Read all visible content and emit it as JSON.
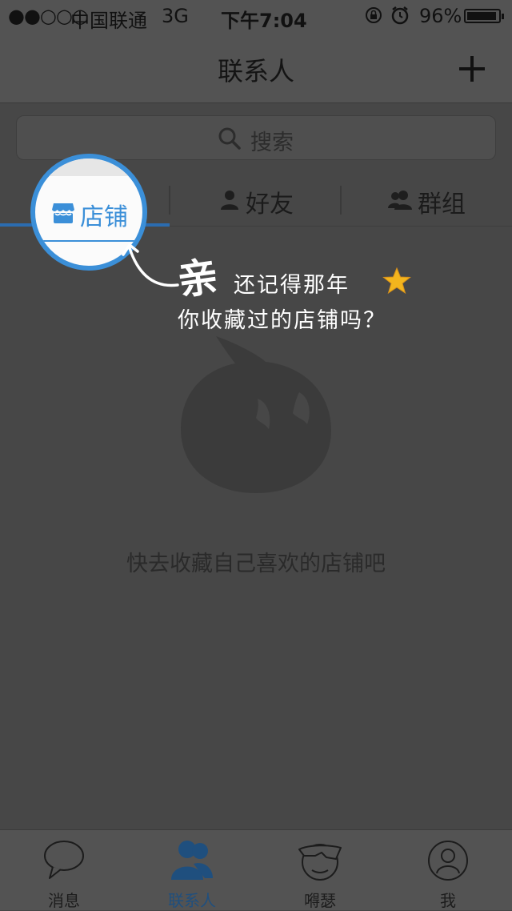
{
  "status_bar": {
    "signal": "●●○○○",
    "carrier": "中国联通",
    "network": "3G",
    "time": "下午7:04",
    "battery_pct": "96%",
    "battery_level": 0.96
  },
  "navbar": {
    "title": "联系人",
    "add_icon": "plus-icon"
  },
  "search": {
    "placeholder": "搜索",
    "icon": "search-icon"
  },
  "tabs": [
    {
      "label": "店铺",
      "icon": "store-icon",
      "active": true
    },
    {
      "label": "好友",
      "icon": "person-icon",
      "active": false
    },
    {
      "label": "群组",
      "icon": "group-icon",
      "active": false
    }
  ],
  "annotation": {
    "big": "亲",
    "line1": "还记得那年",
    "line2": "你收藏过的店铺吗？"
  },
  "empty_state": {
    "message": "快去收藏自己喜欢的店铺吧"
  },
  "tabbar": {
    "items": [
      {
        "label": "消息",
        "icon": "chat-bubble-icon"
      },
      {
        "label": "联系人",
        "icon": "contacts-icon",
        "active": true
      },
      {
        "label": "嘚瑟",
        "icon": "smiley-glasses-icon"
      },
      {
        "label": "我",
        "icon": "profile-icon"
      }
    ]
  },
  "colors": {
    "accent": "#3b8fd8",
    "active_tab": "#1f4f7e",
    "overlay": "#474747"
  }
}
